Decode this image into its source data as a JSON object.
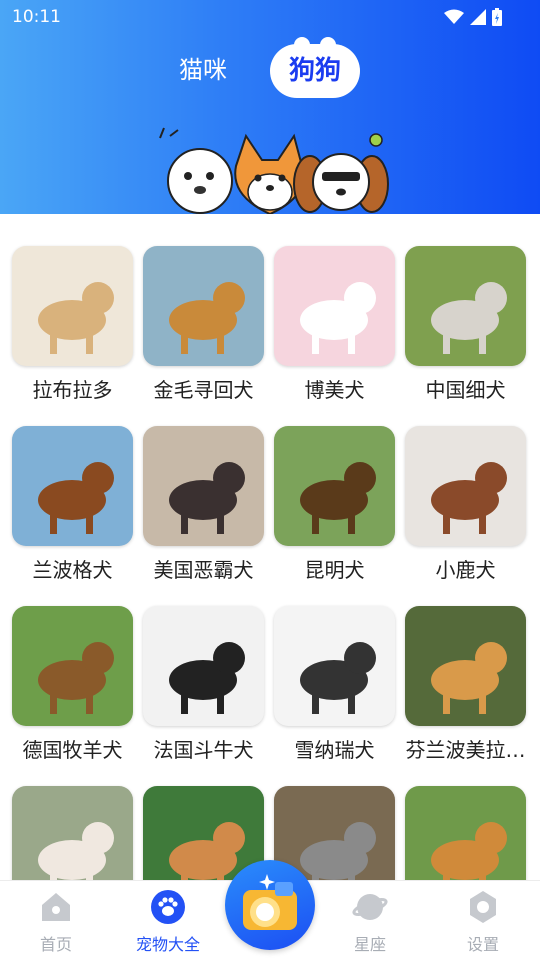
{
  "status": {
    "time": "10:11"
  },
  "tabs": {
    "cats": "猫咪",
    "dogs": "狗狗"
  },
  "breeds": [
    {
      "name": "拉布拉多",
      "bg": "#efe7d9",
      "fg": "#d9b27c"
    },
    {
      "name": "金毛寻回犬",
      "bg": "#8fb3c7",
      "fg": "#c98a3a"
    },
    {
      "name": "博美犬",
      "bg": "#f6d5de",
      "fg": "#ffffff"
    },
    {
      "name": "中国细犬",
      "bg": "#7fa04f",
      "fg": "#d7d3cc"
    },
    {
      "name": "兰波格犬",
      "bg": "#7fb0d6",
      "fg": "#8a4a20"
    },
    {
      "name": "美国恶霸犬",
      "bg": "#c7b9a8",
      "fg": "#3a3030"
    },
    {
      "name": "昆明犬",
      "bg": "#7ca35a",
      "fg": "#5a3a1a"
    },
    {
      "name": "小鹿犬",
      "bg": "#e8e4e0",
      "fg": "#8a4a2a"
    },
    {
      "name": "德国牧羊犬",
      "bg": "#6e9e4a",
      "fg": "#8a5a2a"
    },
    {
      "name": "法国斗牛犬",
      "bg": "#f2f2f2",
      "fg": "#222222"
    },
    {
      "name": "雪纳瑞犬",
      "bg": "#f4f4f4",
      "fg": "#333333"
    },
    {
      "name": "芬兰波美拉…",
      "bg": "#556a3a",
      "fg": "#d99a4a"
    },
    {
      "name": "",
      "bg": "#9aa88a",
      "fg": "#f0e8e0"
    },
    {
      "name": "",
      "bg": "#3f7a3a",
      "fg": "#d18a4a"
    },
    {
      "name": "",
      "bg": "#7a6a52",
      "fg": "#8a8a8a"
    },
    {
      "name": "",
      "bg": "#6f9a4a",
      "fg": "#d08a3a"
    }
  ],
  "nav": {
    "home": "首页",
    "pets": "宠物大全",
    "star": "星座",
    "settings": "设置"
  },
  "colors": {
    "accent": "#2351f5",
    "inactive": "#a8adb5"
  }
}
